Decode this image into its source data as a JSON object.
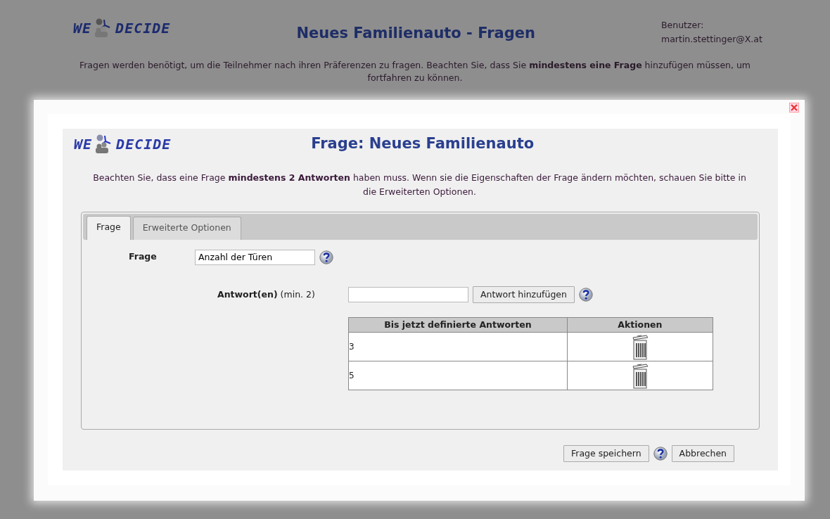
{
  "page_header": {
    "logo": {
      "left": "WE",
      "right": "DECIDE"
    },
    "title": "Neues Familienauto - Fragen",
    "user_label": "Benutzer:",
    "user_email": "martin.stettinger@X.at",
    "description": "Fragen werden benötigt, um die Teilnehmer nach ihren Präferenzen zu fragen. Beachten Sie, dass Sie **mindestens eine Frage** hinzufügen müssen, um fortfahren zu können."
  },
  "dialog": {
    "logo": {
      "left": "WE",
      "right": "DECIDE"
    },
    "title": "Frage: Neues Familienauto",
    "description": "Beachten Sie, dass eine Frage **mindestens 2 Antworten** haben muss. Wenn sie die Eigenschaften der Frage ändern möchten, schauen Sie bitte in die Erweiterten Optionen.",
    "tabs": [
      {
        "label": "Frage",
        "selected": true
      },
      {
        "label": "Erweiterte Optionen",
        "selected": false
      }
    ],
    "question": {
      "label": "Frage",
      "value": "Anzahl der Türen"
    },
    "answer": {
      "label": "Antwort(en)",
      "hint": "(min. 2)",
      "add_button": "Antwort hinzufügen"
    },
    "table": {
      "columns": [
        "Bis jetzt definierte Antworten",
        "Aktionen"
      ],
      "rows": [
        {
          "answer": "3"
        },
        {
          "answer": "5"
        }
      ]
    },
    "save_button": "Frage speichern",
    "cancel_button": "Abbrechen"
  }
}
